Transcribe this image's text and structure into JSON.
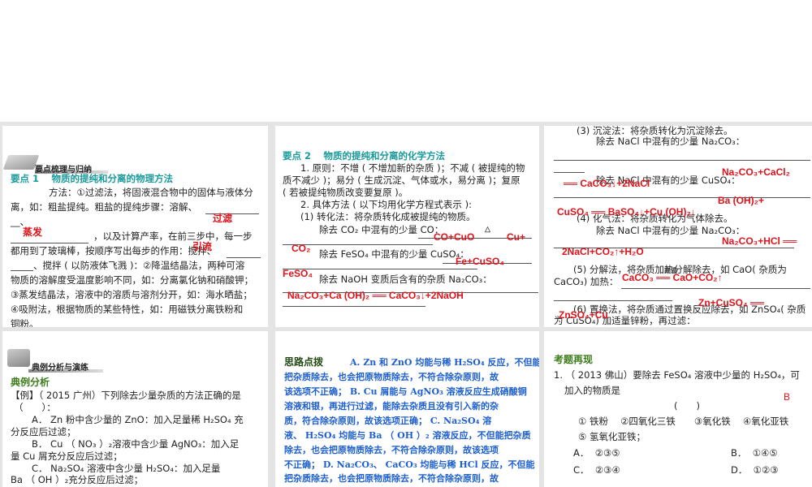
{
  "panel1": {
    "section_label": "要点梳理与归纳",
    "heading": "要点 1　 物质的提纯和分离的物理方法",
    "lines": [
      "方法：①过滤法，将固液混合物中的固体与液体分",
      "离，如：粗盐提纯。粗盐的提纯步骤：溶解、",
      "__、",
      "，以及计算产率，在前三步中，每一步",
      "都用到了玻璃棒，按顺序写出每步的作用：搅拌、",
      "、搅拌 ( 以防液体飞溅 )：②降温结晶法，两种可溶",
      "物质的溶解度受温度影响不同，如：分离氯化钠和硝酸钾；",
      "③蒸发结晶法，溶液中的溶质与溶剂分开，如：海水晒盐；",
      "④吸附法，根据物质的某些特性，如：用磁铁分离铁粉和",
      "铜粉。"
    ],
    "answers": [
      "过滤",
      "蒸发",
      "引流"
    ]
  },
  "panel2": {
    "heading": "要点 2　 物质的提纯和分离的化学方法",
    "lines": [
      "1. 原则：不增 ( 不增加新的杂质 )；不减 ( 被提纯的物",
      "质不减少 )；易分 ( 生成沉淀、气体或水，易分离 )；复原",
      "( 若被提纯物质改变要复原 )。",
      "2. 具体方法 ( 以下均用化学方程式表示 ):",
      "(1) 转化法：将杂质转化成被提纯的物质。",
      "除去 CO₂ 中混有的少量 CO：",
      "除去 FeSO₄ 中混有的少量 CuSO₄：",
      "除去 NaOH 变质后含有的杂质 Na₂CO₃："
    ],
    "answers": [
      "CO+CuO",
      "△",
      "Cu+",
      "CO₂",
      "Fe+CuSO₄",
      "FeSO₄",
      "Na₂CO₃+Ca (OH)₂ ══ CaCO₃↓+2NaOH"
    ]
  },
  "panel3": {
    "lines": [
      "(3) 沉淀法：将杂质转化为沉淀除去。",
      "除去 NaCl 中混有的少量 Na₂CO₃：",
      "除去 NaCl 中混有的少量 CuSO₄：",
      "(4) 化气法：将杂质转化为气体除去。",
      "除去 NaCl 中混有的少量 Na₂CO₃：",
      "(5) 分解法，将杂质加热分解除去，如 CaO( 杂质为",
      "CaCO₃) 加热：",
      "(6) 置换法，将杂质通过置换反应除去，如 ZnSO₄( 杂质",
      "为 CuSO₄) 加适量锌粉，再过滤："
    ],
    "answers": [
      "Na₂CO₃+CaCl₂",
      "══ CaCO₃↓+2NaCl",
      "Ba (OH)₂+",
      "CuSO₄ ══ BaSO₄↓+Cu (OH)₂↓",
      "Na₂CO₃+HCl ══",
      "2NaCl+CO₂↑+H₂O",
      "CaCO₃ ══ CaO+CO₂↑",
      "高温",
      "Zn+CuSO₄ ══",
      "ZnSO₄+Cu"
    ]
  },
  "panel4": {
    "section_label": "典例分析与演练",
    "heading": "典例分析",
    "lines": [
      "【例】（ 2015 广州）下列除去少量杂质的方法正确的是",
      "（　　）：",
      "A． Zn 粉中含少量的 ZnO：加入足量稀 H₂SO₄ 充",
      "分反应后过滤；",
      "B． Cu （ NO₃ ）₂溶液中含少量 AgNO₃：加入足",
      "量 Cu 屑充分反应后过滤；",
      "C． Na₂SO₄ 溶液中含少量 H₂SO₄：加入足量",
      "Ba （ OH ）₂充分反应后过滤；"
    ]
  },
  "panel5": {
    "heading": "思路点拨",
    "lines": [
      "A. Zn 和 ZnO 均能与稀 H₂SO₄ 反应，不但能",
      "把杂质除去，也会把原物质除去，不符合除杂原则，故",
      "该选项不正确； B. Cu 屑能与 AgNO₃ 溶液反应生成硝酸铜",
      "溶液和银，再进行过滤，能除去杂质且没有引入新的杂",
      "质，符合除杂原则，故该选项正确； C. Na₂SO₄ 溶",
      "液、 H₂SO₄ 均能与 Ba （ OH ）₂ 溶液反应，不但能把杂质",
      "除去，也会把原物质除去，不符合除杂原则，故该选项",
      "不正确； D. Na₂CO₃、 CaCO₃ 均能与稀 HCl 反应，不但能",
      "把杂质除去，也会把原物质除去，不符合除杂原则，故"
    ]
  },
  "panel6": {
    "heading": "考题再现",
    "question": "1. （ 2013 佛山）要除去 FeSO₄ 溶液中少量的 H₂SO₄，可",
    "question_cont": "加入的物质是",
    "answer": "B",
    "bracket": "(　　)",
    "items_line1": "① 铁粉　 ②四氧化三铁　　③氧化铁　 ④氧化亚铁",
    "items_line2": "⑤ 氢氧化亚铁；",
    "options": [
      {
        "label": "A．",
        "value": "②③⑤"
      },
      {
        "label": "B．",
        "value": "①④⑤"
      },
      {
        "label": "C．",
        "value": "②③④"
      },
      {
        "label": "D．",
        "value": "①②③"
      }
    ]
  }
}
